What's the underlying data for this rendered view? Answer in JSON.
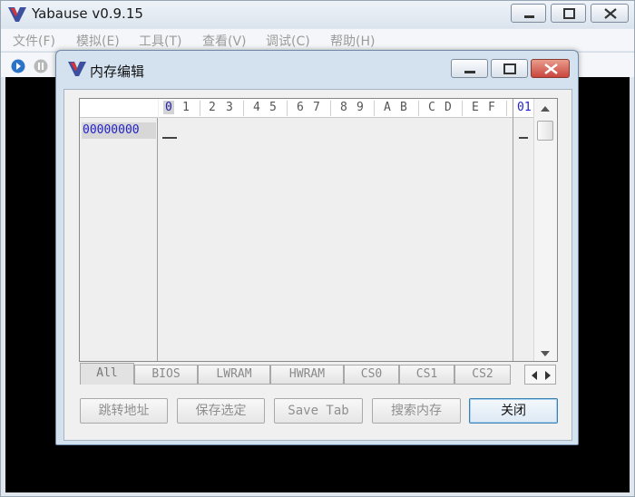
{
  "app": {
    "title": "Yabause v0.9.15",
    "menu": [
      "文件(F)",
      "模拟(E)",
      "工具(T)",
      "查看(V)",
      "调试(C)",
      "帮助(H)"
    ],
    "toolbar_icons": [
      "play-icon",
      "pause-icon"
    ]
  },
  "dialog": {
    "title": "内存编辑",
    "address": "00000000",
    "hex_columns": [
      "0",
      "1",
      "2",
      "3",
      "4",
      "5",
      "6",
      "7",
      "8",
      "9",
      "A",
      "B",
      "C",
      "D",
      "E",
      "F"
    ],
    "right_header": "01",
    "tabs": [
      "All",
      "BIOS",
      "LWRAM",
      "HWRAM",
      "CS0",
      "CS1",
      "CS2"
    ],
    "active_tab": "All",
    "buttons": {
      "goto": "跳转地址",
      "save_selection": "保存选定",
      "save_tab": "Save Tab",
      "search": "搜索内存",
      "close": "关闭"
    }
  },
  "colors": {
    "accent": "#3c7fb1",
    "address_text": "#2222cc",
    "close_button": "#c9463d"
  }
}
